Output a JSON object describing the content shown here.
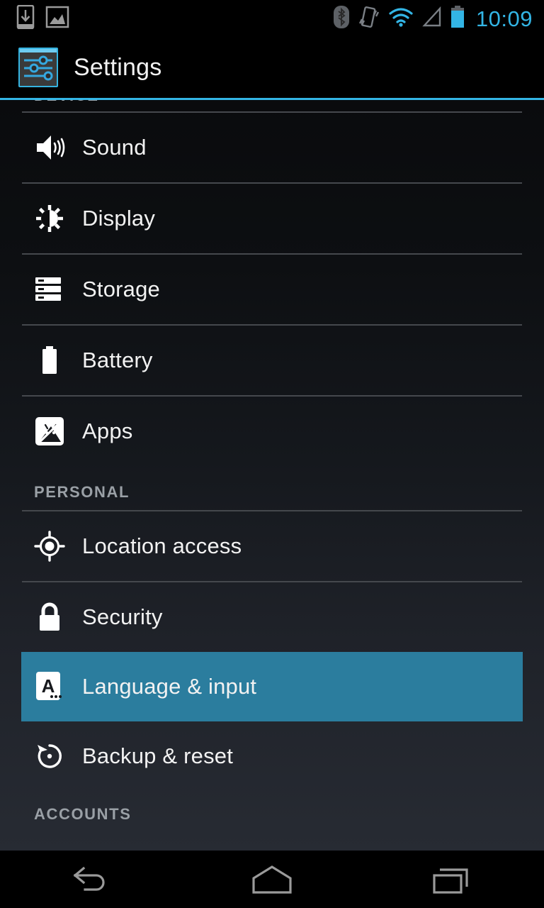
{
  "statusbar": {
    "time": "10:09",
    "left_icons": [
      {
        "name": "download-icon",
        "label": "Download"
      },
      {
        "name": "screenshot-icon",
        "label": "Screenshot"
      }
    ],
    "right_icons": [
      {
        "name": "bluetooth-icon",
        "label": "Bluetooth",
        "color": "#7a7f85"
      },
      {
        "name": "vibrate-icon",
        "label": "Vibrate",
        "color": "#7a7f85"
      },
      {
        "name": "wifi-icon",
        "label": "Wi-Fi",
        "color": "#33b5e5"
      },
      {
        "name": "cell-signal-icon",
        "label": "Mobile signal",
        "color": "#7a7f85"
      },
      {
        "name": "battery-icon",
        "label": "Battery",
        "color": "#33b5e5"
      }
    ],
    "clock_color": "#33b5e5"
  },
  "actionbar": {
    "title": "Settings",
    "icon": "settings-sliders-icon",
    "accent_color": "#33b5e5"
  },
  "sections": [
    {
      "header": "DEVICE",
      "clipped": true,
      "items": [
        {
          "label": "Sound",
          "icon": "speaker-icon",
          "selected": false
        },
        {
          "label": "Display",
          "icon": "brightness-icon",
          "selected": false
        },
        {
          "label": "Storage",
          "icon": "storage-icon",
          "selected": false
        },
        {
          "label": "Battery",
          "icon": "battery-full-icon",
          "selected": false
        },
        {
          "label": "Apps",
          "icon": "apps-android-icon",
          "selected": false
        }
      ]
    },
    {
      "header": "PERSONAL",
      "clipped": false,
      "items": [
        {
          "label": "Location access",
          "icon": "location-crosshair-icon",
          "selected": false
        },
        {
          "label": "Security",
          "icon": "lock-icon",
          "selected": false
        },
        {
          "label": "Language & input",
          "icon": "language-a-icon",
          "selected": true
        },
        {
          "label": "Backup & reset",
          "icon": "restore-icon",
          "selected": false
        }
      ]
    },
    {
      "header": "ACCOUNTS",
      "clipped": false,
      "items": []
    }
  ],
  "selection": {
    "highlight_color": "#2b7d9e",
    "selected_label": "Language & input"
  },
  "navbar": {
    "buttons": [
      {
        "name": "back-button",
        "label": "Back"
      },
      {
        "name": "home-button",
        "label": "Home"
      },
      {
        "name": "recents-button",
        "label": "Recent apps"
      }
    ],
    "icon_color": "#9a9a9a"
  }
}
